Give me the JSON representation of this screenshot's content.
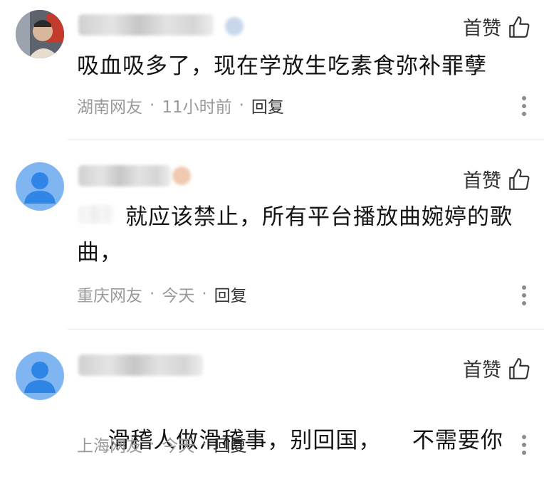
{
  "comments": [
    {
      "like_label": "首赞",
      "text": "吸血吸多了，现在学放生吃素食弥补罪孽",
      "location": "湖南网友",
      "time": "11小时前",
      "reply_label": "回复"
    },
    {
      "like_label": "首赞",
      "text": "就应该禁止，所有平台播放曲婉婷的歌曲，",
      "location": "重庆网友",
      "time": "今天",
      "reply_label": "回复"
    },
    {
      "like_label": "首赞",
      "text": "滑稽人做滑稽事，别回国，    不需要你",
      "location": "上海网友",
      "time": "今天",
      "reply_label": "回复"
    }
  ],
  "separator": "·",
  "icons": {
    "like": "thumbs-up-icon",
    "more": "more-vertical-icon"
  },
  "colors": {
    "text": "#141414",
    "meta": "#9a9a9a",
    "avatar_default": "#7fb5f0"
  }
}
